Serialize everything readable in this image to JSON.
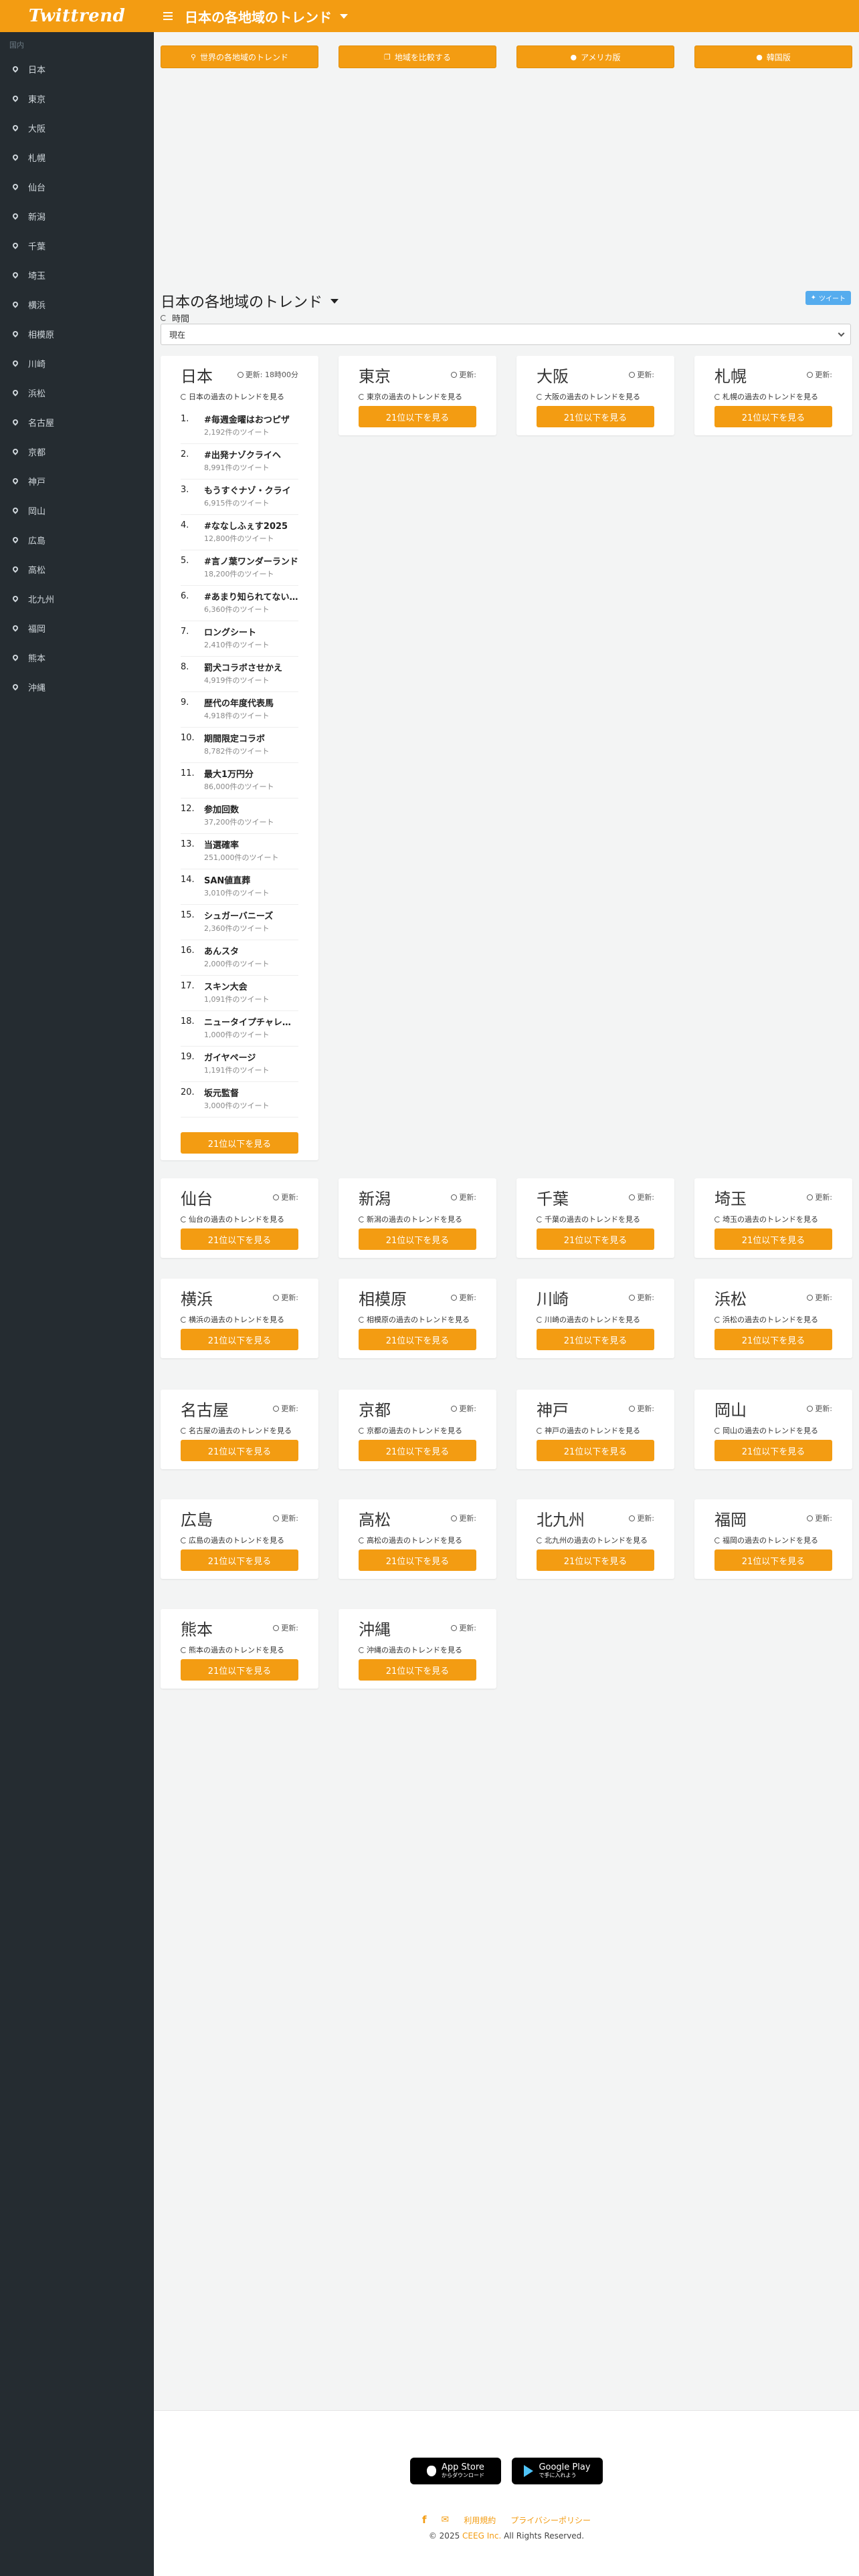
{
  "brand": "Twittrend",
  "sidebar": {
    "section_label": "国内",
    "items": [
      "日本",
      "東京",
      "大阪",
      "札幌",
      "仙台",
      "新潟",
      "千葉",
      "埼玉",
      "横浜",
      "相模原",
      "川崎",
      "浜松",
      "名古屋",
      "京都",
      "神戸",
      "岡山",
      "広島",
      "高松",
      "北九州",
      "福岡",
      "熊本",
      "沖縄"
    ]
  },
  "header": {
    "title": "日本の各地域のトレンド"
  },
  "top_buttons": [
    {
      "label": "世界の各地域のトレンド",
      "icon": "map-marker-icon"
    },
    {
      "label": "地域を比較する",
      "icon": "copy-icon"
    },
    {
      "label": "アメリカ版",
      "icon": "globe-icon"
    },
    {
      "label": "韓国版",
      "icon": "globe-icon"
    }
  ],
  "section": {
    "title": "日本の各地域のトレンド",
    "tweet_label": "ツイート",
    "time_label": "時間",
    "time_value": "現在"
  },
  "japan_card": {
    "name": "日本",
    "updated": "更新: 18時00分",
    "history": "日本の過去のトレンドを見る",
    "button": "21位以下を見る",
    "trends": [
      {
        "rank": "1.",
        "name": "#毎週金曜はおつピザ",
        "count": "2,192件のツイート"
      },
      {
        "rank": "2.",
        "name": "#出発ナゾクライヘ",
        "count": "8,991件のツイート"
      },
      {
        "rank": "3.",
        "name": "もうすぐナゾ・クライ",
        "count": "6,915件のツイート"
      },
      {
        "rank": "4.",
        "name": "#ななしふぇす2025",
        "count": "12,800件のツイート"
      },
      {
        "rank": "5.",
        "name": "#言ノ葉ワンダーランド",
        "count": "18,200件のツイート"
      },
      {
        "rank": "6.",
        "name": "#あまり知られてない...",
        "count": "6,360件のツイート"
      },
      {
        "rank": "7.",
        "name": "ロングシート",
        "count": "2,410件のツイート"
      },
      {
        "rank": "8.",
        "name": "罰犬コラボさせかえ",
        "count": "4,919件のツイート"
      },
      {
        "rank": "9.",
        "name": "歴代の年度代表馬",
        "count": "4,918件のツイート"
      },
      {
        "rank": "10.",
        "name": "期間限定コラボ",
        "count": "8,782件のツイート"
      },
      {
        "rank": "11.",
        "name": "最大1万円分",
        "count": "86,000件のツイート"
      },
      {
        "rank": "12.",
        "name": "参加回数",
        "count": "37,200件のツイート"
      },
      {
        "rank": "13.",
        "name": "当選確率",
        "count": "251,000件のツイート"
      },
      {
        "rank": "14.",
        "name": "SAN値直葬",
        "count": "3,010件のツイート"
      },
      {
        "rank": "15.",
        "name": "シュガーバニーズ",
        "count": "2,360件のツイート"
      },
      {
        "rank": "16.",
        "name": "あんスタ",
        "count": "2,000件のツイート"
      },
      {
        "rank": "17.",
        "name": "スキン大会",
        "count": "1,091件のツイート"
      },
      {
        "rank": "18.",
        "name": "ニュータイプチャレンジ",
        "count": "1,000件のツイート"
      },
      {
        "rank": "19.",
        "name": "ガイヤページ",
        "count": "1,191件のツイート"
      },
      {
        "rank": "20.",
        "name": "坂元監督",
        "count": "3,000件のツイート"
      }
    ]
  },
  "cards": [
    {
      "name": "東京",
      "updated": "更新:",
      "history": "東京の過去のトレンドを見る",
      "button": "21位以下を見る"
    },
    {
      "name": "大阪",
      "updated": "更新:",
      "history": "大阪の過去のトレンドを見る",
      "button": "21位以下を見る"
    },
    {
      "name": "札幌",
      "updated": "更新:",
      "history": "札幌の過去のトレンドを見る",
      "button": "21位以下を見る"
    },
    {
      "name": "仙台",
      "updated": "更新:",
      "history": "仙台の過去のトレンドを見る",
      "button": "21位以下を見る"
    },
    {
      "name": "新潟",
      "updated": "更新:",
      "history": "新潟の過去のトレンドを見る",
      "button": "21位以下を見る"
    },
    {
      "name": "千葉",
      "updated": "更新:",
      "history": "千葉の過去のトレンドを見る",
      "button": "21位以下を見る"
    },
    {
      "name": "埼玉",
      "updated": "更新:",
      "history": "埼玉の過去のトレンドを見る",
      "button": "21位以下を見る"
    },
    {
      "name": "横浜",
      "updated": "更新:",
      "history": "横浜の過去のトレンドを見る",
      "button": "21位以下を見る"
    },
    {
      "name": "相模原",
      "updated": "更新:",
      "history": "相模原の過去のトレンドを見る",
      "button": "21位以下を見る"
    },
    {
      "name": "川崎",
      "updated": "更新:",
      "history": "川崎の過去のトレンドを見る",
      "button": "21位以下を見る"
    },
    {
      "name": "浜松",
      "updated": "更新:",
      "history": "浜松の過去のトレンドを見る",
      "button": "21位以下を見る"
    },
    {
      "name": "名古屋",
      "updated": "更新:",
      "history": "名古屋の過去のトレンドを見る",
      "button": "21位以下を見る"
    },
    {
      "name": "京都",
      "updated": "更新:",
      "history": "京都の過去のトレンドを見る",
      "button": "21位以下を見る"
    },
    {
      "name": "神戸",
      "updated": "更新:",
      "history": "神戸の過去のトレンドを見る",
      "button": "21位以下を見る"
    },
    {
      "name": "岡山",
      "updated": "更新:",
      "history": "岡山の過去のトレンドを見る",
      "button": "21位以下を見る"
    },
    {
      "name": "広島",
      "updated": "更新:",
      "history": "広島の過去のトレンドを見る",
      "button": "21位以下を見る"
    },
    {
      "name": "高松",
      "updated": "更新:",
      "history": "高松の過去のトレンドを見る",
      "button": "21位以下を見る"
    },
    {
      "name": "北九州",
      "updated": "更新:",
      "history": "北九州の過去のトレンドを見る",
      "button": "21位以下を見る"
    },
    {
      "name": "福岡",
      "updated": "更新:",
      "history": "福岡の過去のトレンドを見る",
      "button": "21位以下を見る"
    },
    {
      "name": "熊本",
      "updated": "更新:",
      "history": "熊本の過去のトレンドを見る",
      "button": "21位以下を見る"
    },
    {
      "name": "沖縄",
      "updated": "更新:",
      "history": "沖縄の過去のトレンドを見る",
      "button": "21位以下を見る"
    }
  ],
  "footer": {
    "app_store_big": "App Store",
    "app_store_small": "からダウンロード",
    "google_play_big": "Google Play",
    "google_play_small": "で手に入れよう",
    "terms": "利用規約",
    "privacy": "プライバシーポリシー",
    "copyright_prefix": "© 2025",
    "company": "CEEG Inc.",
    "copyright_suffix": "All Rights Reserved."
  },
  "colors": {
    "accent": "#f39c12",
    "sidebar": "#252c31",
    "tweet": "#55acee"
  }
}
